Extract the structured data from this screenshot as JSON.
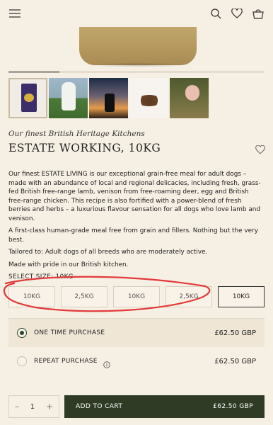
{
  "header": {
    "menu_icon": "hamburger-icon",
    "logo_icon": "tree-logo-icon",
    "search_icon": "search-icon",
    "wishlist_icon": "heart-icon",
    "cart_icon": "basket-icon"
  },
  "gallery": {
    "progress": 0.2,
    "thumbnails": [
      {
        "name": "product-pack"
      },
      {
        "name": "dogs-in-field"
      },
      {
        "name": "deer-sunset"
      },
      {
        "name": "kibble"
      },
      {
        "name": "hand-with-food"
      }
    ]
  },
  "product": {
    "subtitle": "Our finest British Heritage Kitchens",
    "title": "ESTATE WORKING, 10KG",
    "description": [
      "Our finest ESTATE LIVING is our exceptional grain-free meal for adult dogs – made with an abundance of local and regional delicacies, including fresh, grass-fed British free-range lamb, venison from free-roaming deer, egg and British free-range chicken. This recipe is also fortified with a power-blend of fresh berries and herbs – a luxurious flavour sensation for all dogs who love lamb and venison.",
      "A first-class human-grade meal free from grain and fillers. Nothing but the very best.",
      "Tailored to: Adult dogs of all breeds who are moderately active.",
      "Made with pride in our British kitchen."
    ]
  },
  "sizes": {
    "label": "SELECT SIZE: 10KG",
    "options": [
      "10KG",
      "2,5KG",
      "10KG",
      "2,5KG",
      "10KG"
    ],
    "selected_index": 4
  },
  "purchase": {
    "options": [
      {
        "label": "ONE TIME PURCHASE",
        "price": "£62.50 GBP",
        "selected": true
      },
      {
        "label": "REPEAT PURCHASE",
        "price": "£62.50 GBP",
        "selected": false
      }
    ],
    "info_icon": "info-icon"
  },
  "cart": {
    "quantity": "1",
    "minus": "–",
    "plus": "+",
    "button_label": "ADD TO CART",
    "button_price": "£62.50 GBP"
  },
  "colors": {
    "background": "#f6efe3",
    "accent": "#2f3b24",
    "annotation": "#e23b3b"
  }
}
